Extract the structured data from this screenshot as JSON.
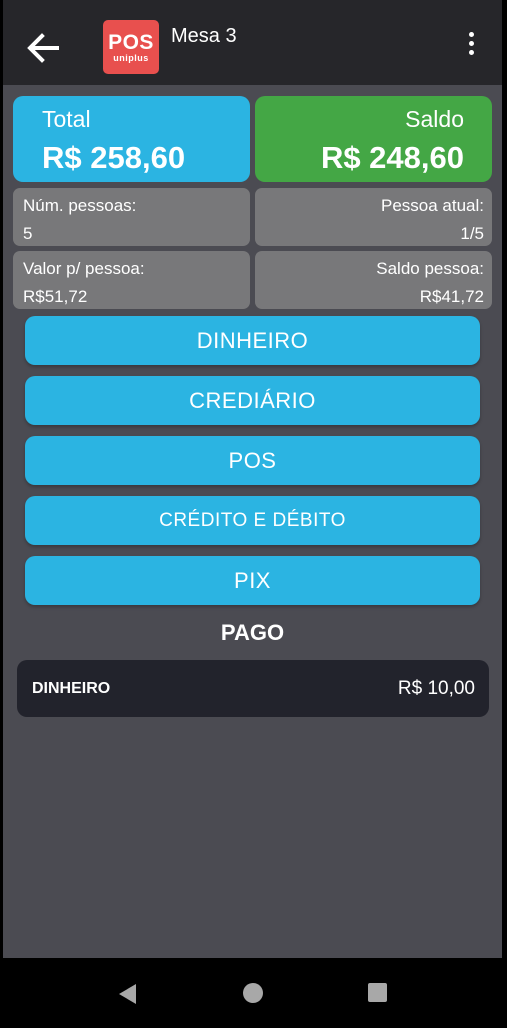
{
  "header": {
    "title": "Mesa 3",
    "logo": {
      "line1": "POS",
      "line2": "uniplus",
      "color": "#e8504e"
    },
    "back_icon": "arrow-left-icon",
    "menu_icon": "more-vert-icon"
  },
  "summary": {
    "total_label": "Total",
    "total_value": "R$ 258,60",
    "saldo_label": "Saldo",
    "saldo_value": "R$ 248,60",
    "total_color": "#2bb4e2",
    "saldo_color": "#44a745"
  },
  "info": {
    "num_pessoas_label": "Núm. pessoas:",
    "num_pessoas_value": "5",
    "pessoa_atual_label": "Pessoa atual:",
    "pessoa_atual_value": "1/5",
    "valor_pessoa_label": "Valor p/ pessoa:",
    "valor_pessoa_value": "R$51,72",
    "saldo_pessoa_label": "Saldo pessoa:",
    "saldo_pessoa_value": "R$41,72"
  },
  "payment_methods": {
    "dinheiro": "DINHEIRO",
    "crediario": "CREDIÁRIO",
    "pos": "POS",
    "credito_debito": "CRÉDITO E DÉBITO",
    "pix": "PIX"
  },
  "paid": {
    "title": "PAGO",
    "items": [
      {
        "method": "DINHEIRO",
        "amount": "R$ 10,00"
      }
    ]
  },
  "navigation": {
    "back_icon": "nav-back-icon",
    "home_icon": "nav-home-icon",
    "recent_icon": "nav-recents-icon"
  }
}
